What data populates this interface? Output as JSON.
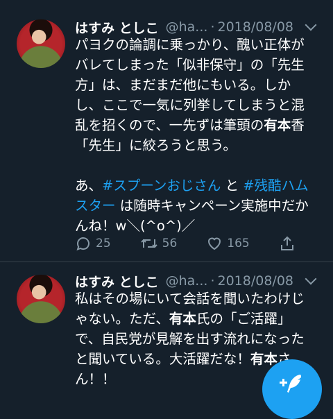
{
  "tweets": [
    {
      "name": "はすみ としこ",
      "handle": "@ha...",
      "separator": "·",
      "date": "2018/08/08",
      "lines": [
        "パヨクの論調に乗っかり、醜い正体が",
        "バレてしまった「似非保守」の「先生",
        "方」は、まだまだ他にもいる。しか",
        "し、ここで一気に列挙してしまうと混"
      ],
      "line5_before": "乱を招くので、一先ずは筆頭の",
      "line5_bold": "有本",
      "line5_after": "香",
      "line6": "「先生」に絞ろうと思う。",
      "line8_prefix": "あ、",
      "line8_tag1": "#スプーンおじさん",
      "line8_mid": " と ",
      "line8_tag2a": "#残酷ハム",
      "line9_tag2b": "スター",
      "line9_rest": " は随時キャンペーン実施中だか",
      "line10": "んね！w＼(^o^)／",
      "replies": "25",
      "retweets": "56",
      "likes": "165"
    },
    {
      "name": "はすみ としこ",
      "handle": "@ha...",
      "separator": "·",
      "date": "2018/08/08",
      "line1": "私はその場にいて会話を聞いたわけじ",
      "line2_before": "ゃない。ただ、",
      "line2_bold": "有本",
      "line2_after": "氏の「ご活躍」",
      "line3": "で、自民党が見解を出す流れになった",
      "line4_before": "と聞いている。大活躍だな！",
      "line4_bold": "有本",
      "line4_after": "さ",
      "line5": "ん！！"
    }
  ],
  "colors": {
    "background": "#15202b",
    "accent": "#1da1f2",
    "secondary_text": "#8899a6",
    "divider": "#38444d"
  },
  "icons": {
    "reply": "speech-bubble-icon",
    "retweet": "retweet-arrows-icon",
    "like": "heart-icon",
    "share": "share-upload-icon",
    "compose": "feather-plus-icon"
  }
}
